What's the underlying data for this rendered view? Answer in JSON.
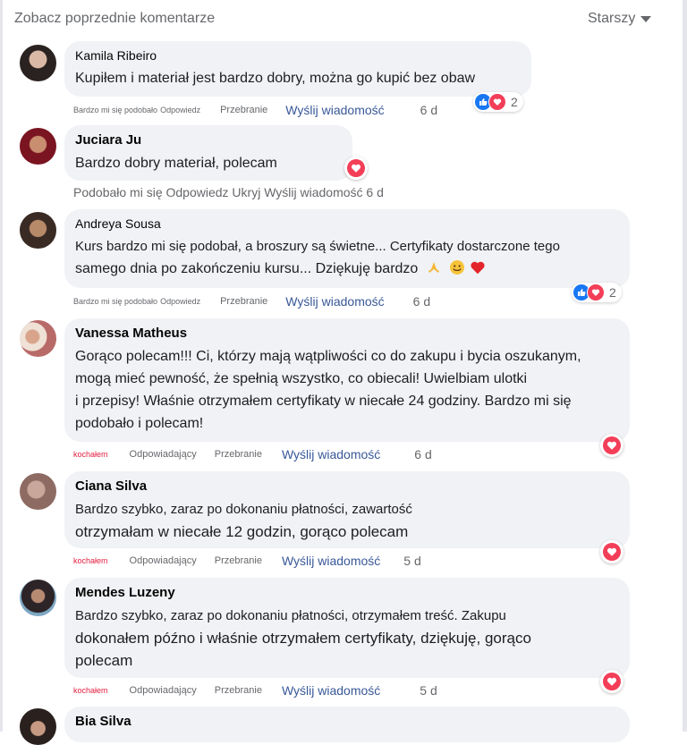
{
  "header": {
    "previous_comments": "Zobacz poprzednie komentarze",
    "sort_label": "Starszy"
  },
  "comments": [
    {
      "author": "Kamila Ribeiro",
      "lines": [
        "Kupiłem i materiał jest bardzo dobry, można go kupić bez obaw"
      ],
      "actions": {
        "like": "Bardzo mi się podobało",
        "reply": "Odpowiedz",
        "translate": "Przebranie",
        "send": "Wyślij wiadomość",
        "time": "6 d"
      },
      "reactions": {
        "types": [
          "like-icon",
          "love-icon"
        ],
        "count": "2"
      }
    },
    {
      "author": "Juciara Ju",
      "lines": [
        "Bardzo dobry materiał, polecam"
      ],
      "actions_text": "Podobało mi się Odpowiedz Ukryj Wyślij wiadomość 6 d",
      "reactions": {
        "types": [
          "love-icon"
        ]
      }
    },
    {
      "author": "Andreya Sousa",
      "lines": [
        "Kurs bardzo mi się podobał, a broszury są świetne... Certyfikaty dostarczone tego",
        "samego dnia po zakończeniu kursu... Dziękuję bardzo"
      ],
      "emojis": [
        "praying-hands-emoji",
        "smiling-face-emoji",
        "red-heart-emoji"
      ],
      "actions": {
        "like": "Bardzo mi się podobało",
        "reply": "Odpowiedz",
        "translate": "Przebranie",
        "send": "Wyślij wiadomość",
        "time": "6 d"
      },
      "reactions": {
        "types": [
          "like-icon",
          "love-icon"
        ],
        "count": "2"
      }
    },
    {
      "author": "Vanessa Matheus",
      "lines": [
        "Gorąco polecam!!! Ci, którzy mają wątpliwości co do zakupu i bycia oszukanym,",
        "mogą mieć pewność, że spełnią wszystko, co obiecali! Uwielbiam ulotki",
        "i przepisy! Właśnie otrzymałem certyfikaty w niecałe 24 godziny. Bardzo mi się",
        "podobało i polecam!"
      ],
      "actions": {
        "like": "kochałem",
        "reply": "Odpowiadający",
        "translate": "Przebranie",
        "send": "Wyślij wiadomość",
        "time": "6 d"
      },
      "reactions": {
        "types": [
          "love-icon"
        ]
      }
    },
    {
      "author": "Ciana Silva",
      "lines": [
        "Bardzo szybko, zaraz po dokonaniu płatności, zawartość",
        "otrzymałam w niecałe 12 godzin, gorąco polecam"
      ],
      "actions": {
        "like": "kochałem",
        "reply": "Odpowiadający",
        "translate": "Przebranie",
        "send": "Wyślij wiadomość",
        "time": "5 d"
      },
      "reactions": {
        "types": [
          "love-icon"
        ]
      }
    },
    {
      "author": "Mendes Luzeny",
      "lines": [
        "Bardzo szybko, zaraz po dokonaniu płatności, otrzymałem treść. Zakupu",
        "dokonałem późno i właśnie otrzymałem certyfikaty, dziękuję, gorąco",
        "polecam"
      ],
      "actions": {
        "like": "kochałem",
        "reply": "Odpowiadający",
        "translate": "Przebranie",
        "send": "Wyślij wiadomość",
        "time": "5 d"
      },
      "reactions": {
        "types": [
          "love-icon"
        ]
      }
    },
    {
      "author": "Bia Silva",
      "lines": []
    }
  ],
  "colors": {
    "accent_link": "#385898",
    "love": "#f33e58",
    "like": "#1877f2",
    "bubble": "#f0f2f5"
  }
}
